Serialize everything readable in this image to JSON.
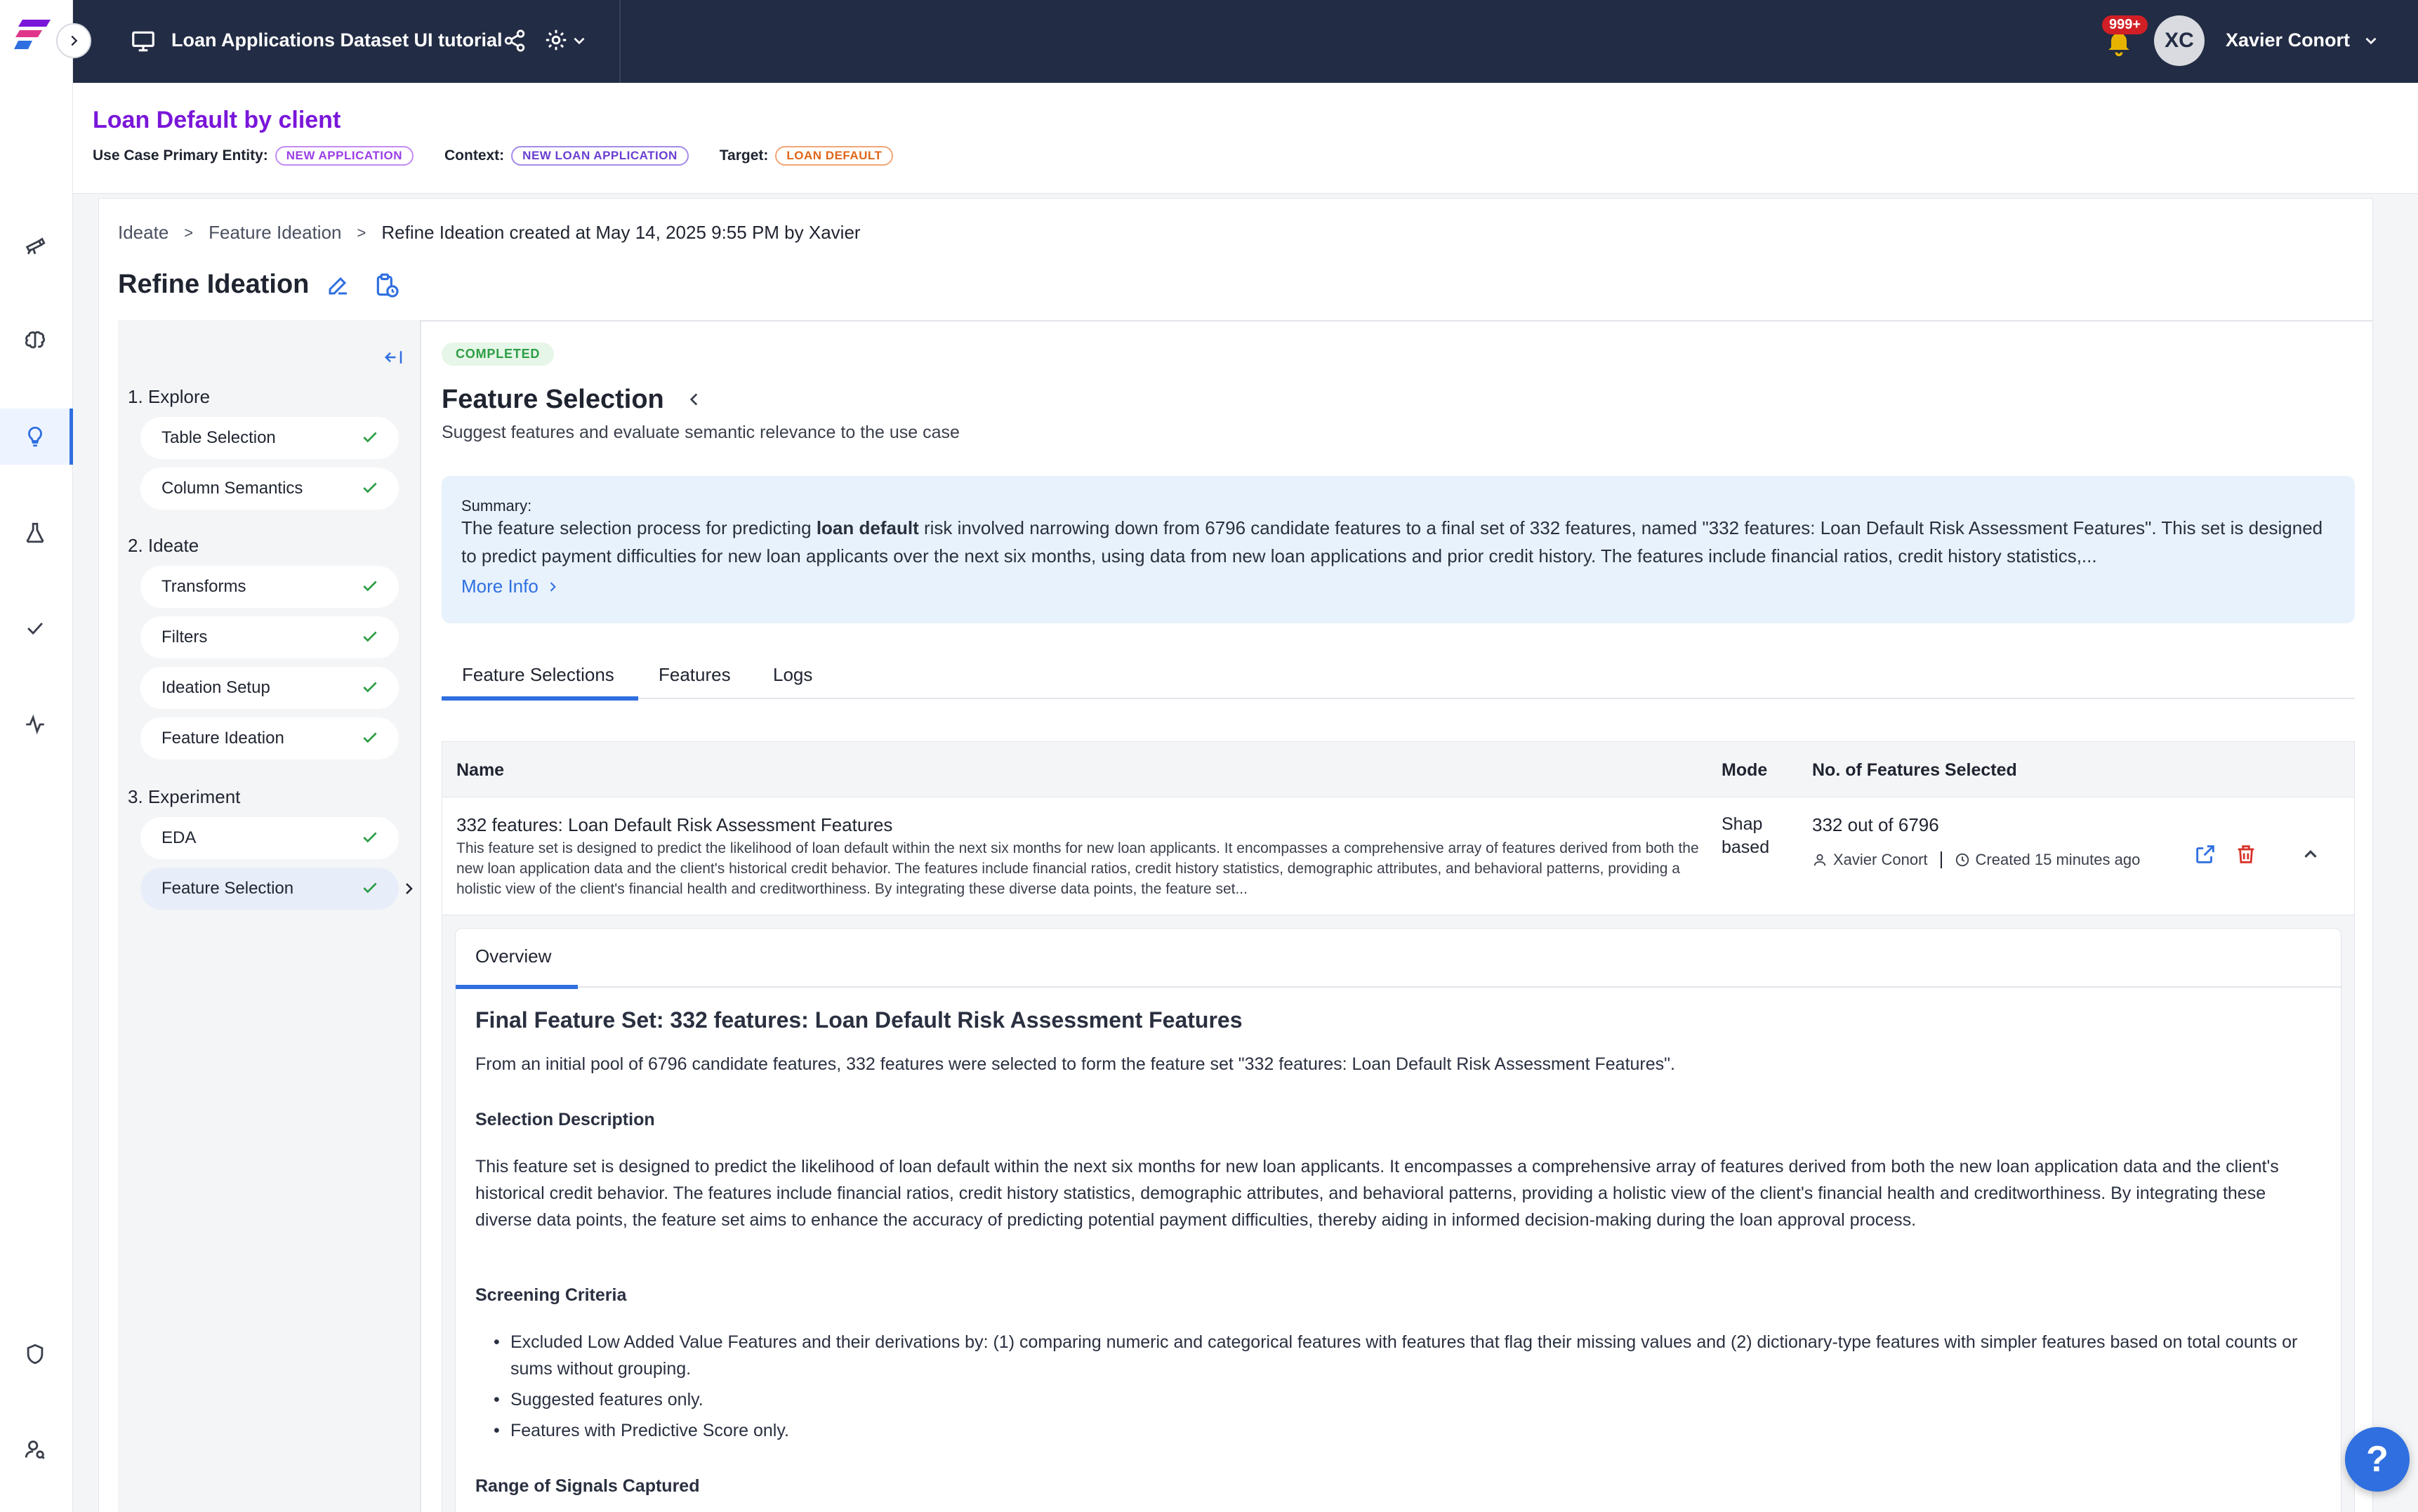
{
  "topbar": {
    "workspace_title": "Loan Applications Dataset UI tutorial",
    "notifications_count": "999+",
    "user_initials": "XC",
    "user_name": "Xavier Conort"
  },
  "use_case": {
    "title": "Loan Default by client",
    "primary_entity_label": "Use Case Primary Entity:",
    "primary_entity_value": "NEW APPLICATION",
    "context_label": "Context:",
    "context_value": "NEW LOAN APPLICATION",
    "target_label": "Target:",
    "target_value": "LOAN DEFAULT"
  },
  "breadcrumb": {
    "items": [
      "Ideate",
      "Feature Ideation",
      "Refine Ideation created at May 14, 2025 9:55 PM by Xavier"
    ],
    "separator": ">"
  },
  "page": {
    "title": "Refine Ideation"
  },
  "steps": {
    "sections": [
      {
        "label": "1. Explore",
        "items": [
          "Table Selection",
          "Column Semantics"
        ]
      },
      {
        "label": "2. Ideate",
        "items": [
          "Transforms",
          "Filters",
          "Ideation Setup",
          "Feature Ideation"
        ]
      },
      {
        "label": "3. Experiment",
        "items": [
          "EDA",
          "Feature Selection"
        ]
      }
    ],
    "selected": "Feature Selection"
  },
  "content": {
    "status_badge": "COMPLETED",
    "title": "Feature Selection",
    "subtitle": "Suggest features and evaluate semantic relevance to the use case",
    "summary_label": "Summary:",
    "summary_pre": "The feature selection process for predicting ",
    "summary_bold": "loan default",
    "summary_post": " risk involved narrowing down from 6796 candidate features to a final set of 332 features, named \"332 features: Loan Default Risk Assessment Features\". This set is designed to predict payment difficulties for new loan applicants over the next six months, using data from new loan applications and prior credit history. The features include financial ratios, credit history statistics,...",
    "more_info": "More Info",
    "tabs": [
      "Feature Selections",
      "Features",
      "Logs"
    ],
    "active_tab": "Feature Selections"
  },
  "table": {
    "columns": [
      "Name",
      "Mode",
      "No. of Features Selected"
    ],
    "rows": [
      {
        "name": "332 features: Loan Default Risk Assessment Features",
        "description": "This feature set is designed to predict the likelihood of loan default within the next six months for new loan applicants. It encompasses a comprehensive array of features derived from both the new loan application data and the client's historical credit behavior. The features include financial ratios, credit history statistics, demographic attributes, and behavioral patterns, providing a holistic view of the client's financial health and creditworthiness. By integrating these diverse data points, the feature set...",
        "mode_line1": "Shap",
        "mode_line2": "based",
        "count": "332 out of 6796",
        "author": "Xavier Conort",
        "created": "Created 15 minutes ago"
      }
    ]
  },
  "detail": {
    "tab": "Overview",
    "heading": "Final Feature Set: 332 features: Loan Default Risk Assessment Features",
    "intro": "From an initial pool of 6796 candidate features, 332 features were selected to form the feature set \"332 features: Loan Default Risk Assessment Features\".",
    "selection_heading": "Selection Description",
    "selection_text": "This feature set is designed to predict the likelihood of loan default within the next six months for new loan applicants. It encompasses a comprehensive array of features derived from both the new loan application data and the client's historical credit behavior. The features include financial ratios, credit history statistics, demographic attributes, and behavioral patterns, providing a holistic view of the client's financial health and creditworthiness. By integrating these diverse data points, the feature set aims to enhance the accuracy of predicting potential payment difficulties, thereby aiding in informed decision-making during the loan approval process.",
    "screening_heading": "Screening Criteria",
    "screening_items": [
      "Excluded Low Added Value Features and their derivations by: (1) comparing numeric and categorical features with features that flag their missing values and (2) dictionary-type features with simpler features based on total counts or sums without grouping.",
      "Suggested features only.",
      "Features with Predictive Score only."
    ],
    "range_heading": "Range of Signals Captured"
  },
  "help": {
    "label": "?"
  },
  "colors": {
    "topbar_bg": "#222c44",
    "accent_blue": "#2f6fe0",
    "use_case_purple": "#7a16d9",
    "success_green": "#2e9e46",
    "delete_red": "#d9342b",
    "target_orange": "#e0661a"
  }
}
